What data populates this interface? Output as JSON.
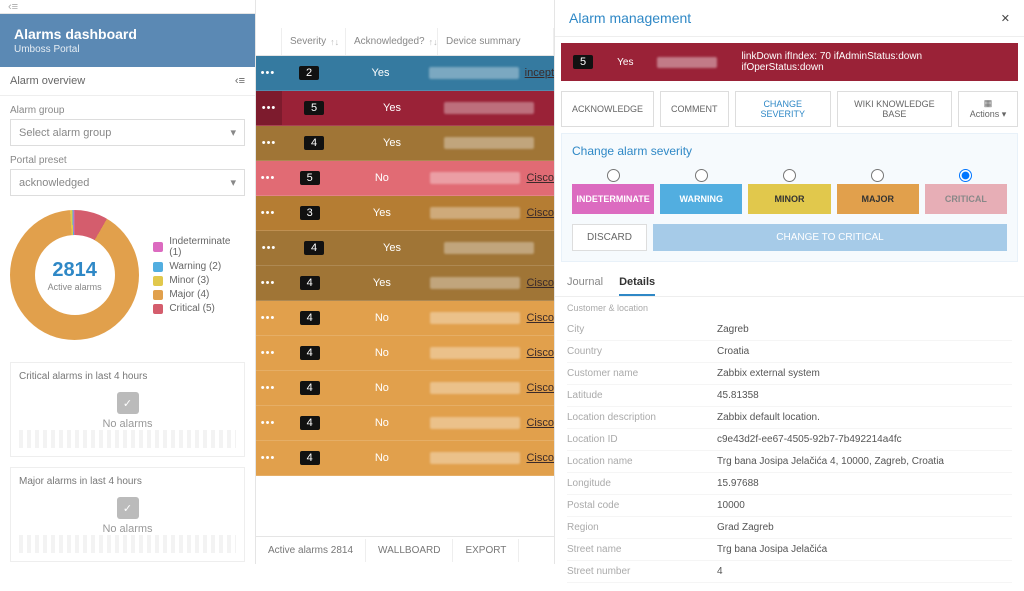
{
  "header": {
    "title": "Alarms dashboard",
    "subtitle": "Umboss Portal",
    "overview": "Alarm overview"
  },
  "filters": {
    "group_label": "Alarm group",
    "group_value": "Select alarm group",
    "preset_label": "Portal preset",
    "preset_value": "acknowledged"
  },
  "donut": {
    "count": "2814",
    "label": "Active alarms",
    "legend": [
      {
        "color": "#dc6bc0",
        "label": "Indeterminate (1)"
      },
      {
        "color": "#52aee0",
        "label": "Warning (2)"
      },
      {
        "color": "#e1c84c",
        "label": "Minor (3)"
      },
      {
        "color": "#e1a04c",
        "label": "Major (4)"
      },
      {
        "color": "#d45d6d",
        "label": "Critical (5)"
      }
    ]
  },
  "cards": {
    "crit": "Critical alarms in last 4 hours",
    "maj": "Major alarms in last 4 hours",
    "none": "No alarms"
  },
  "table": {
    "severity": "Severity",
    "ack": "Acknowledged?",
    "device": "Device summary",
    "rows": [
      {
        "cls": "r-info",
        "sev": "2",
        "ack": "Yes",
        "link": "incept"
      },
      {
        "cls": "r-crit",
        "sev": "5",
        "ack": "Yes",
        "link": ""
      },
      {
        "cls": "r-min",
        "sev": "4",
        "ack": "Yes",
        "link": ""
      },
      {
        "cls": "r-pink",
        "sev": "5",
        "ack": "No",
        "link": "Cisco"
      },
      {
        "cls": "r-maj2",
        "sev": "3",
        "ack": "Yes",
        "link": "Cisco"
      },
      {
        "cls": "r-min",
        "sev": "4",
        "ack": "Yes",
        "link": ""
      },
      {
        "cls": "r-min",
        "sev": "4",
        "ack": "Yes",
        "link": "Cisco"
      },
      {
        "cls": "r-maj",
        "sev": "4",
        "ack": "No",
        "link": "Cisco"
      },
      {
        "cls": "r-maj",
        "sev": "4",
        "ack": "No",
        "link": "Cisco"
      },
      {
        "cls": "r-maj",
        "sev": "4",
        "ack": "No",
        "link": "Cisco"
      },
      {
        "cls": "r-maj",
        "sev": "4",
        "ack": "No",
        "link": "Cisco"
      },
      {
        "cls": "r-maj",
        "sev": "4",
        "ack": "No",
        "link": "Cisco"
      }
    ],
    "footer": {
      "active": "Active alarms 2814",
      "wall": "WALLBOARD",
      "exp": "EXPORT"
    }
  },
  "panel": {
    "title": "Alarm management",
    "alarm": {
      "sev": "5",
      "ack": "Yes",
      "msg": "linkDown ifIndex:        70 ifAdminStatus:down ifOperStatus:down"
    },
    "actions": {
      "ack": "ACKNOWLEDGE",
      "com": "COMMENT",
      "chg": "CHANGE SEVERITY",
      "wiki": "WIKI KNOWLEDGE BASE",
      "more": "Actions"
    },
    "sev": {
      "title": "Change alarm severity",
      "opts": [
        "INDETERMINATE",
        "WARNING",
        "MINOR",
        "MAJOR",
        "CRITICAL"
      ],
      "discard": "DISCARD",
      "go": "CHANGE TO CRITICAL"
    },
    "tabs": {
      "journal": "Journal",
      "details": "Details"
    },
    "section": "Customer & location",
    "details": [
      {
        "k": "City",
        "v": "Zagreb"
      },
      {
        "k": "Country",
        "v": "Croatia"
      },
      {
        "k": "Customer name",
        "v": "Zabbix external system"
      },
      {
        "k": "Latitude",
        "v": "45.81358"
      },
      {
        "k": "Location description",
        "v": "Zabbix default location."
      },
      {
        "k": "Location ID",
        "v": "c9e43d2f-ee67-4505-92b7-7b492214a4fc"
      },
      {
        "k": "Location name",
        "v": "Trg bana Josipa Jelačića 4, 10000, Zagreb, Croatia"
      },
      {
        "k": "Longitude",
        "v": "15.97688"
      },
      {
        "k": "Postal code",
        "v": "10000"
      },
      {
        "k": "Region",
        "v": "Grad Zagreb"
      },
      {
        "k": "Street name",
        "v": "Trg bana Josipa Jelačića"
      },
      {
        "k": "Street number",
        "v": "4"
      }
    ]
  }
}
